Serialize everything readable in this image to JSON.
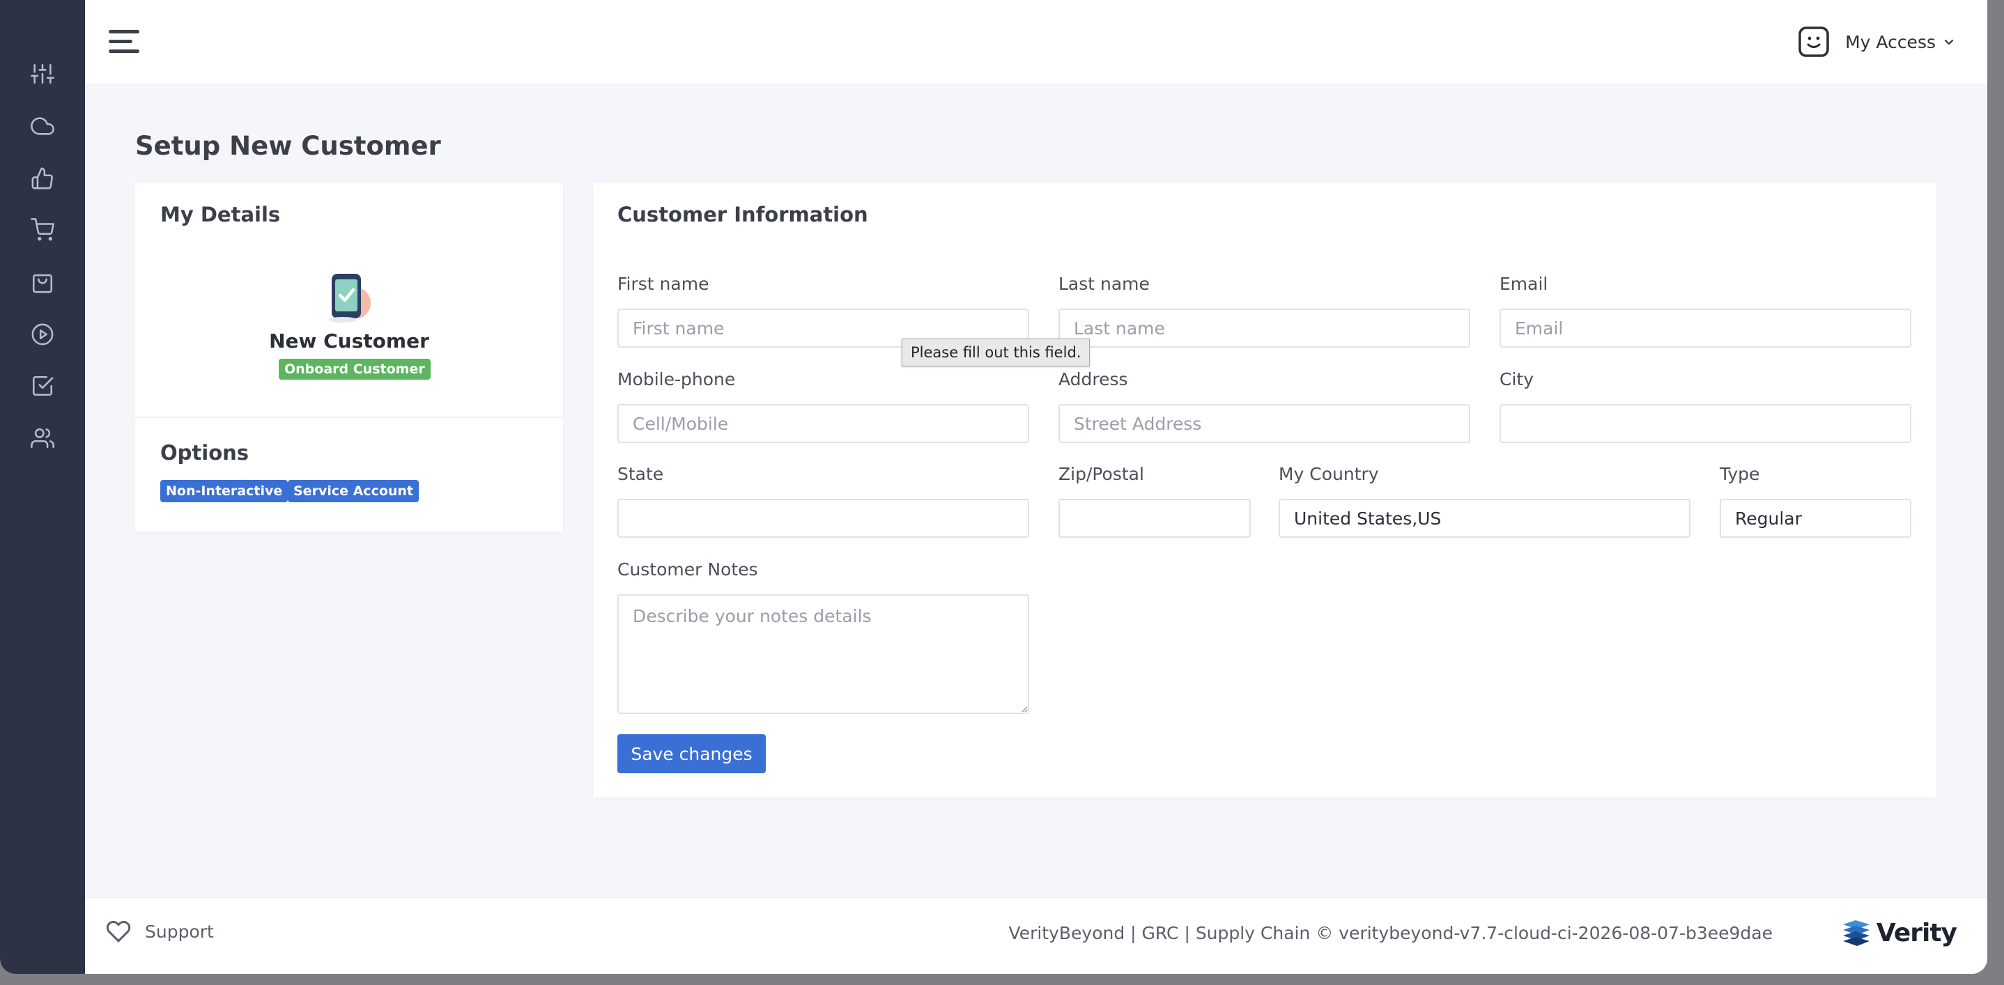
{
  "sidebar": {
    "items": [
      {
        "icon": "sliders-icon"
      },
      {
        "icon": "cloud-icon"
      },
      {
        "icon": "thumbs-up-icon"
      },
      {
        "icon": "cart-icon"
      },
      {
        "icon": "shopping-bag-icon"
      },
      {
        "icon": "play-circle-icon"
      },
      {
        "icon": "check-square-icon"
      },
      {
        "icon": "users-icon"
      }
    ]
  },
  "header": {
    "menu_icon": "hamburger-icon",
    "user_icon": "smiley-face-icon",
    "access_label": "My Access"
  },
  "page": {
    "title": "Setup New Customer"
  },
  "details": {
    "heading": "My Details",
    "customer_name": "New Customer",
    "status_badge": "Onboard Customer",
    "options_heading": "Options",
    "option_badges": [
      "Non-Interactive",
      "Service Account"
    ]
  },
  "form": {
    "heading": "Customer Information",
    "first_name": {
      "label": "First name",
      "placeholder": "First name",
      "value": ""
    },
    "last_name": {
      "label": "Last name",
      "placeholder": "Last name",
      "value": ""
    },
    "email": {
      "label": "Email",
      "placeholder": "Email",
      "value": ""
    },
    "mobile": {
      "label": "Mobile-phone",
      "placeholder": "Cell/Mobile",
      "value": ""
    },
    "address": {
      "label": "Address",
      "placeholder": "Street Address",
      "value": ""
    },
    "city": {
      "label": "City",
      "value": ""
    },
    "state": {
      "label": "State",
      "value": ""
    },
    "zip": {
      "label": "Zip/Postal",
      "value": ""
    },
    "country": {
      "label": "My Country",
      "value": "United States,US"
    },
    "type": {
      "label": "Type",
      "value": "Regular"
    },
    "notes": {
      "label": "Customer Notes",
      "placeholder": "Describe your notes details"
    },
    "validation_tooltip": "Please fill out this field.",
    "save_label": "Save changes"
  },
  "footer": {
    "support_label": "Support",
    "version_text": "VerityBeyond | GRC | Supply Chain © veritybeyond-v7.7-cloud-ci-2026-08-07-b3ee9dae",
    "logo_text": "Verity"
  },
  "colors": {
    "sidebar_bg": "#2d3244",
    "primary": "#3a6fd6",
    "success": "#5cb55f"
  }
}
